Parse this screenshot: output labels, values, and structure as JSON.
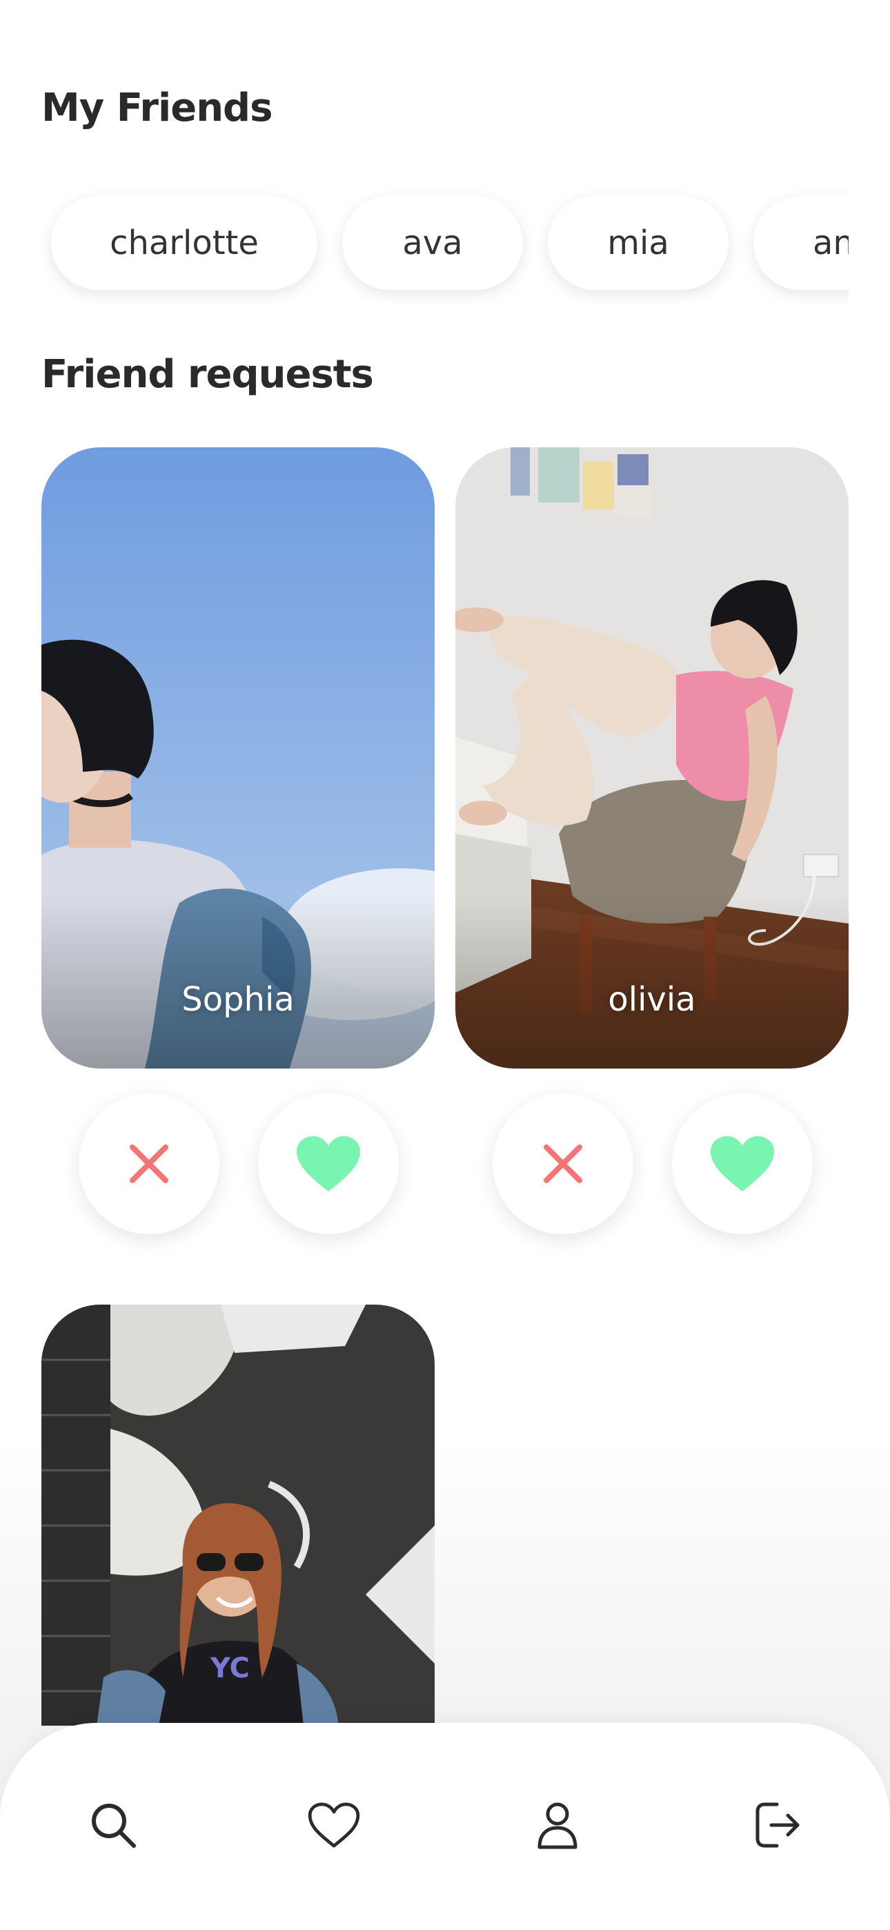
{
  "friends": {
    "title": "My Friends",
    "chips": [
      "charlotte",
      "ava",
      "mia",
      "an"
    ]
  },
  "requests": {
    "title": "Friend requests",
    "cards": [
      {
        "name": "Sophia"
      },
      {
        "name": "olivia"
      },
      {
        "name": ""
      }
    ]
  },
  "colors": {
    "reject": "#f47575",
    "accept": "#7af5b1",
    "icon_dark": "#2b2b2b"
  },
  "icons": {
    "reject": "close-icon",
    "accept": "heart-filled-icon",
    "nav": [
      "search-icon",
      "heart-outline-icon",
      "user-icon",
      "logout-icon"
    ]
  }
}
